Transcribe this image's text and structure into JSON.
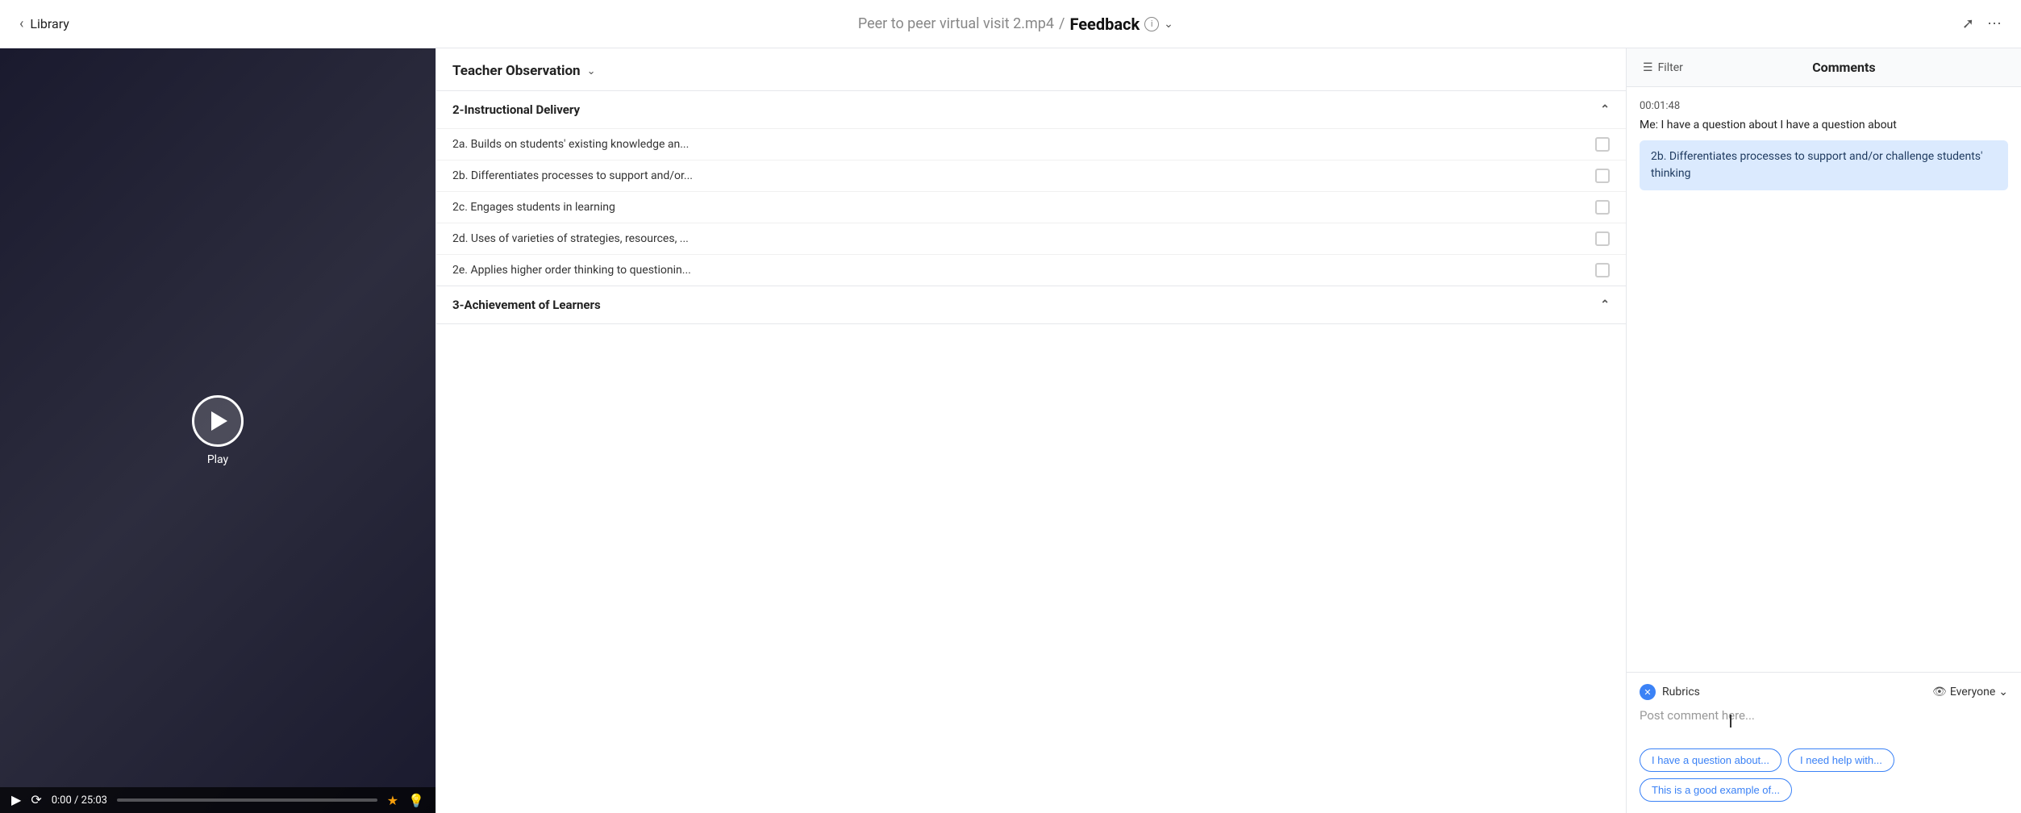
{
  "topbar": {
    "back_label": "Library",
    "breadcrumb_file": "Peer to peer virtual visit 2.mp4",
    "breadcrumb_sep": "/",
    "breadcrumb_active": "Feedback",
    "share_icon": "share",
    "more_icon": "more"
  },
  "video": {
    "play_label": "Play",
    "time_current": "0:00",
    "time_total": "25:03",
    "time_display": "0:00 / 25:03"
  },
  "rubric": {
    "title": "Teacher Observation",
    "sections": [
      {
        "id": "section2",
        "label": "2-Instructional Delivery",
        "expanded": true,
        "items": [
          {
            "id": "2a",
            "label": "2a. Builds on students' existing knowledge an..."
          },
          {
            "id": "2b",
            "label": "2b. Differentiates processes to support and/or..."
          },
          {
            "id": "2c",
            "label": "2c. Engages students in learning"
          },
          {
            "id": "2d",
            "label": "2d. Uses of varieties of strategies, resources, ..."
          },
          {
            "id": "2e",
            "label": "2e. Applies higher order thinking to questionin..."
          }
        ]
      },
      {
        "id": "section3",
        "label": "3-Achievement of Learners",
        "expanded": false,
        "items": []
      }
    ]
  },
  "comments": {
    "title": "Comments",
    "filter_label": "Filter",
    "entries": [
      {
        "timestamp": "00:01:48",
        "text": "Me: I have a question about I have a question about",
        "highlight": "2b. Differentiates processes to support and/or challenge students' thinking"
      }
    ]
  },
  "comment_input": {
    "tag_label": "Rubrics",
    "audience_label": "Everyone",
    "placeholder": "Post comment here...",
    "quick_replies": [
      "I have a question about...",
      "I need help with...",
      "This is a good example of..."
    ]
  }
}
